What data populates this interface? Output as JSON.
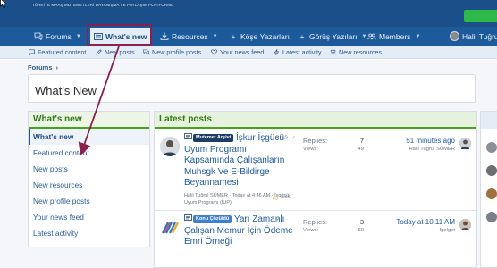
{
  "header": {
    "slogan": "TÜRKİYE MAAŞ MUTEMETLERİ DAYANIŞMA VE PAYLAŞIM PLATFORMU"
  },
  "nav": {
    "items": [
      {
        "label": "Forums",
        "icon": "chat-icon"
      },
      {
        "label": "What's new",
        "icon": "newspaper-icon"
      },
      {
        "label": "Resources",
        "icon": "download-icon"
      },
      {
        "label": "Köşe Yazarları",
        "icon": "plus-icon"
      },
      {
        "label": "Görüş Yazıları",
        "icon": "plus-icon"
      },
      {
        "label": "Members",
        "icon": "users-icon"
      }
    ],
    "user_name": "Halil Tuğrul"
  },
  "subnav": {
    "items": [
      {
        "label": "Featured content",
        "icon": "comment-icon"
      },
      {
        "label": "New posts",
        "icon": "pencil-icon"
      },
      {
        "label": "New profile posts",
        "icon": "comments-icon"
      },
      {
        "label": "Your news feed",
        "icon": "heart-icon"
      },
      {
        "label": "Latest activity",
        "icon": "bolt-icon"
      },
      {
        "label": "New resources",
        "icon": "users-icon"
      }
    ]
  },
  "breadcrumb": {
    "label": "Forums",
    "separator": "›"
  },
  "page": {
    "title": "What's New"
  },
  "sidebar": {
    "heading": "What's new",
    "items": [
      {
        "label": "What's new"
      },
      {
        "label": "Featured content"
      },
      {
        "label": "New posts"
      },
      {
        "label": "New resources"
      },
      {
        "label": "New profile posts"
      },
      {
        "label": "Your news feed"
      },
      {
        "label": "Latest activity"
      }
    ]
  },
  "latest": {
    "heading": "Latest posts",
    "threads": [
      {
        "prefix": "Mutemet Arşivi",
        "title": "İşkur İşgücü Uyum Programı Kapsamında Çalışanların Muhsgk Ve E-Bildirge Beyannamesi",
        "meta": "Halil Tuğrul SÜMER · Today at 4:46 AM · İşgücü Uyum Programı (İUP)",
        "edit_label": "Edit",
        "replies_label": "Replies:",
        "replies": "7",
        "views_label": "Views:",
        "views": "49",
        "last_time": "51 minutes ago",
        "last_user": "Halil Tuğrul SÜMER"
      },
      {
        "prefix": "Konu Çözüldü",
        "title": "Yarı Zamanlı Çalışan Memur İçin Ödeme Emri Örneği",
        "replies_label": "Replies:",
        "replies": "3",
        "views_label": "Views:",
        "views": "69",
        "last_time": "Today at 10:11 AM",
        "last_user": "fgelget"
      }
    ]
  },
  "colors": {
    "header_bg": "#1b4f8a",
    "nav_bg": "#1c5a9c",
    "accent_green": "#47a21d",
    "link_blue": "#2b5a93",
    "annotation": "#8b1f4f"
  }
}
